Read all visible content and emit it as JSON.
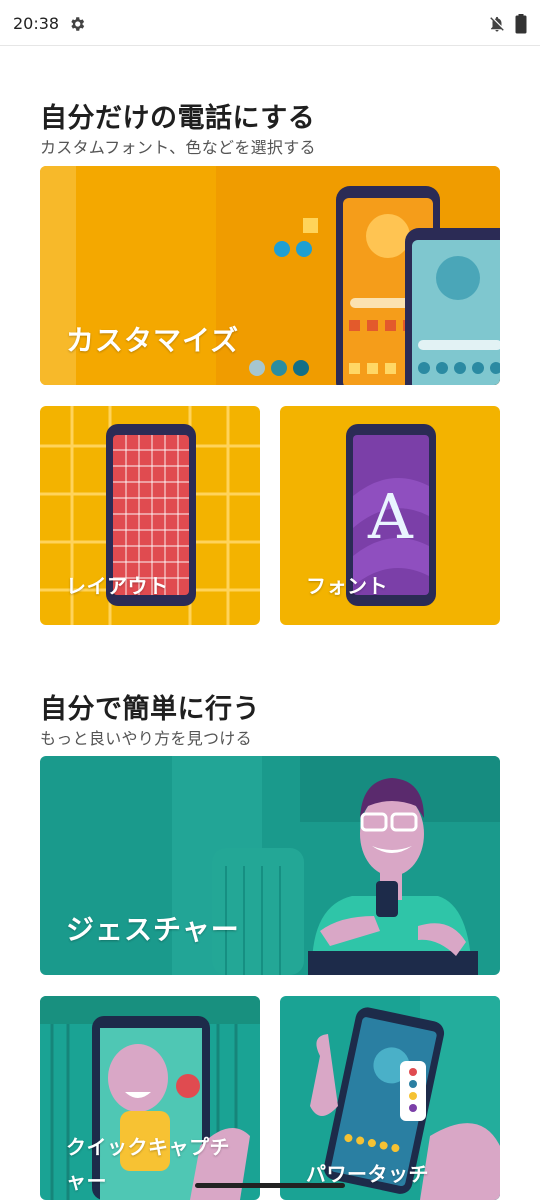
{
  "status_bar": {
    "time": "20:38",
    "icons": [
      "gear-icon",
      "notifications-muted-icon",
      "battery-icon"
    ]
  },
  "sections": [
    {
      "title": "自分だけの電話にする",
      "subtitle": "カスタムフォント、色などを選択する",
      "cards": [
        {
          "label": "カスタマイズ",
          "icon": "customize-illustration"
        },
        {
          "label": "レイアウト",
          "icon": "layout-illustration"
        },
        {
          "label": "フォント",
          "icon": "font-illustration",
          "glyph": "A"
        }
      ]
    },
    {
      "title": "自分で簡単に行う",
      "subtitle": "もっと良いやり方を見つける",
      "cards": [
        {
          "label": "ジェスチャー",
          "icon": "gesture-illustration"
        },
        {
          "label": "クイックキャプチ\nャー",
          "icon": "quick-capture-illustration"
        },
        {
          "label": "パワータッチ",
          "icon": "power-touch-illustration"
        }
      ]
    }
  ],
  "colors": {
    "yellow": "#f5b400",
    "orange": "#f09a00",
    "teal": "#1a9a8c",
    "purple": "#7b3fa8",
    "red": "#e04b50"
  }
}
